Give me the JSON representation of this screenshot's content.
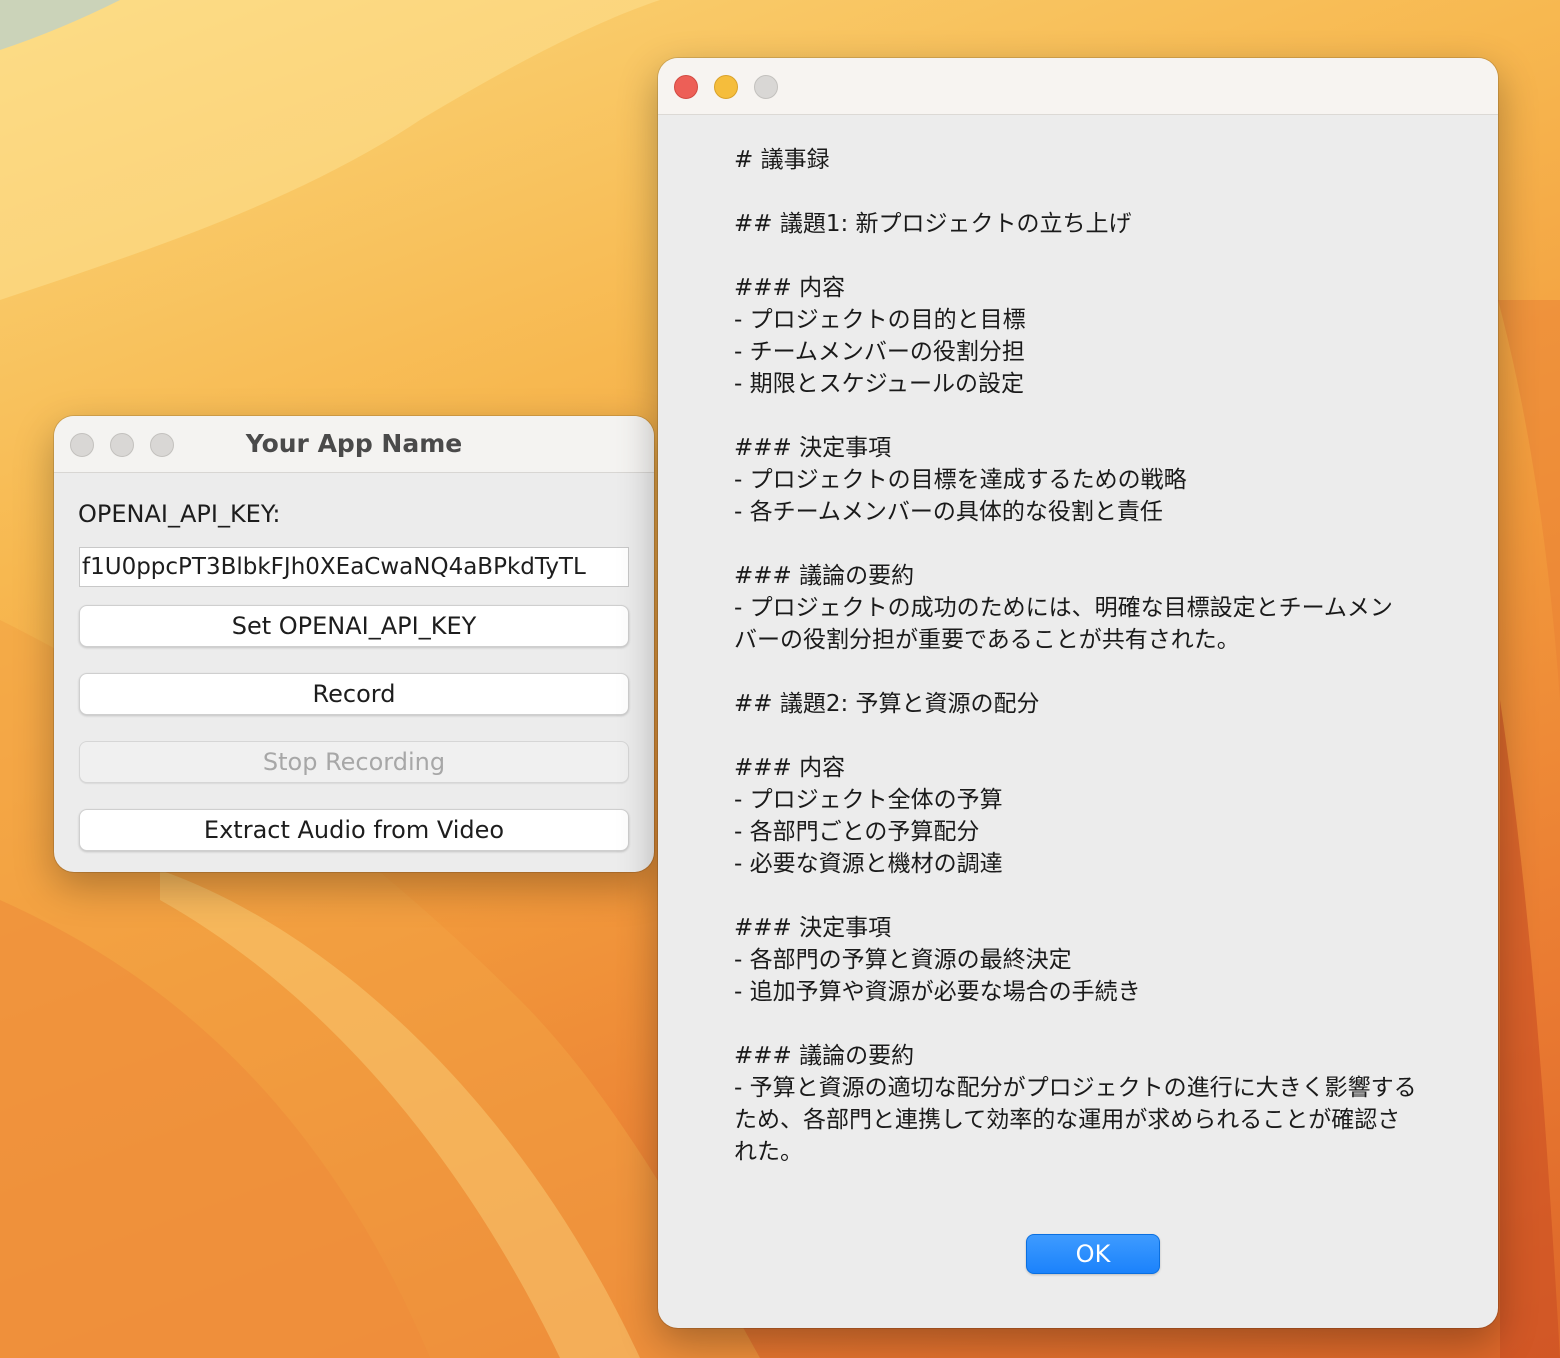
{
  "app_window": {
    "title": "Your App Name",
    "api_key_label": "OPENAI_API_KEY:",
    "api_key_value": "f1U0ppcPT3BlbkFJh0XEaCwaNQ4aBPkdTyTL",
    "buttons": {
      "set_key": "Set OPENAI_API_KEY",
      "record": "Record",
      "stop_recording": "Stop Recording",
      "extract_audio": "Extract Audio from Video"
    }
  },
  "dialog_window": {
    "message": "# 議事録\n\n## 議題1: 新プロジェクトの立ち上げ\n\n### 内容\n- プロジェクトの目的と目標\n- チームメンバーの役割分担\n- 期限とスケジュールの設定\n\n### 決定事項\n- プロジェクトの目標を達成するための戦略\n- 各チームメンバーの具体的な役割と責任\n\n### 議論の要約\n- プロジェクトの成功のためには、明確な目標設定とチームメン\nバーの役割分担が重要であることが共有された。\n\n## 議題2: 予算と資源の配分\n\n### 内容\n- プロジェクト全体の予算\n- 各部門ごとの予算配分\n- 必要な資源と機材の調達\n\n### 決定事項\n- 各部門の予算と資源の最終決定\n- 追加予算や資源が必要な場合の手続き\n\n### 議論の要約\n- 予算と資源の適切な配分がプロジェクトの進行に大きく影響する\nため、各部門と連携して効率的な運用が求められることが確認さ\nれた。",
    "ok_label": "OK"
  },
  "colors": {
    "accent_blue": "#1b82fb",
    "close_red": "#ed5f57",
    "minimize_yellow": "#f5bd3c",
    "inactive_gray": "#d9d7d5"
  }
}
